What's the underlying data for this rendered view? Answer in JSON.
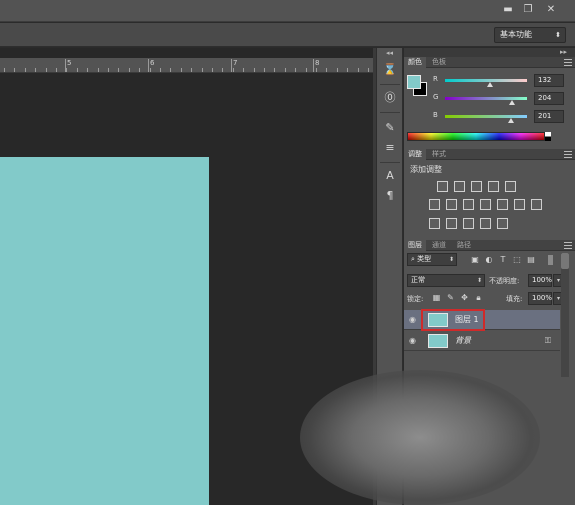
{
  "window": {
    "minimize_icon": "minimize-icon",
    "restore_icon": "restore-icon",
    "close_icon": "close-icon",
    "minimize_glyph": "▬",
    "restore_glyph": "❐",
    "close_glyph": "✕"
  },
  "options_bar": {
    "workspace": "基本功能"
  },
  "ruler": {
    "labels": [
      "5",
      "6",
      "7",
      "8"
    ]
  },
  "canvas": {
    "fill_color": "#82cac9"
  },
  "color_panel": {
    "tabs": [
      "颜色",
      "色板"
    ],
    "foreground_color": "#82cac9",
    "background_color": "#000000",
    "r_label": "R",
    "g_label": "G",
    "b_label": "B",
    "r_value": "132",
    "g_value": "204",
    "b_value": "201"
  },
  "adjustments_panel": {
    "tabs": [
      "调整",
      "样式"
    ],
    "title": "添加调整"
  },
  "layers_panel": {
    "tabs": [
      "图层",
      "通道",
      "路径"
    ],
    "filter_kind": "类型",
    "blend_mode": "正常",
    "opacity_label": "不透明度:",
    "opacity_value": "100%",
    "lock_label": "锁定:",
    "fill_label": "填充:",
    "fill_value": "100%",
    "layers": [
      {
        "name": "图层 1",
        "selected": true,
        "thumb_color": "#82cac9"
      },
      {
        "name": "背景",
        "selected": false,
        "locked": true,
        "thumb_color": "#82cac9"
      }
    ]
  },
  "accent": {
    "highlight": "#d02a2a",
    "selection": "#6a7080"
  }
}
